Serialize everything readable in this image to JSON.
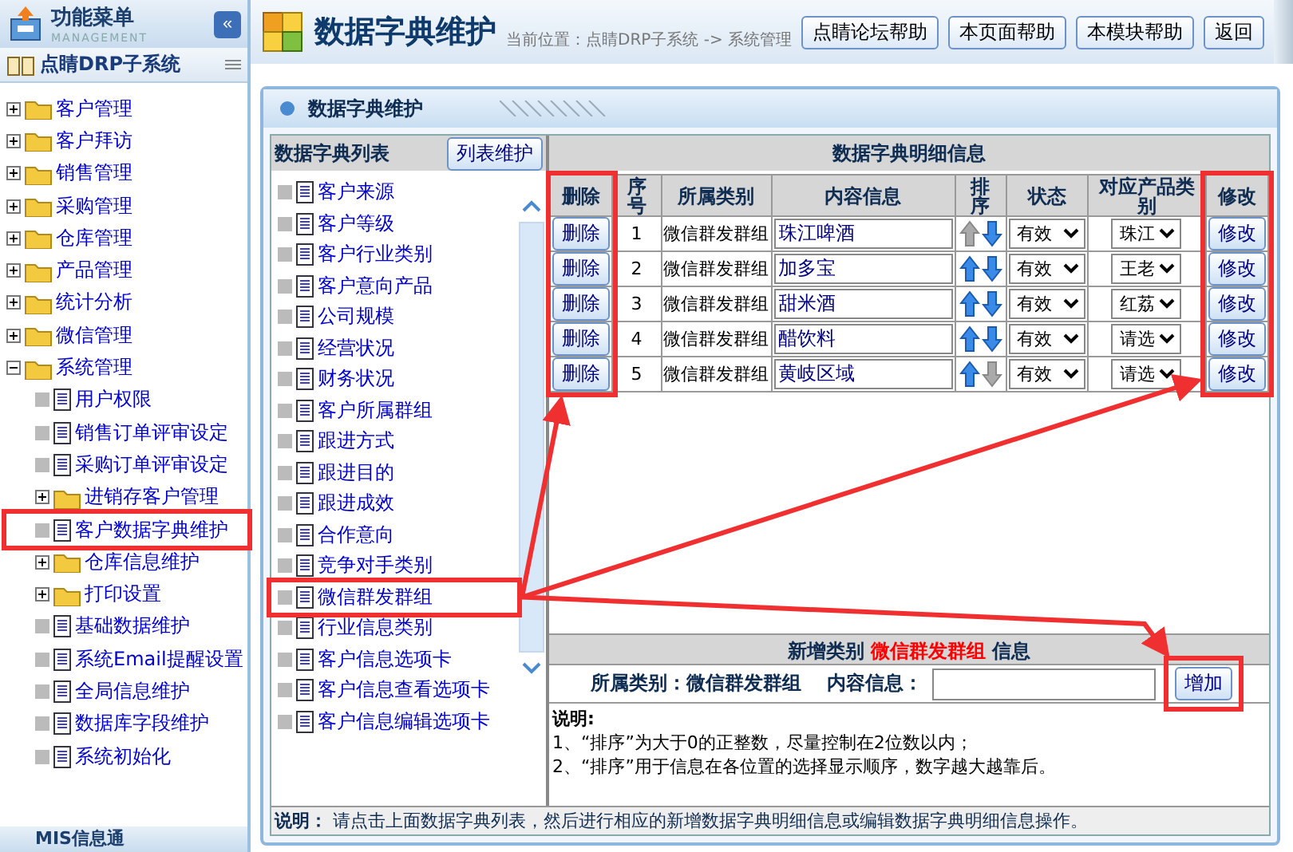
{
  "sidebar": {
    "title": "功能菜单",
    "subtitle": "MANAGEMENT",
    "collapse_symbol": "«",
    "system": "点睛DRP子系统",
    "items": [
      {
        "label": "客户管理",
        "kind": "folder",
        "expanded": false
      },
      {
        "label": "客户拜访",
        "kind": "folder",
        "expanded": false
      },
      {
        "label": "销售管理",
        "kind": "folder",
        "expanded": false
      },
      {
        "label": "采购管理",
        "kind": "folder",
        "expanded": false
      },
      {
        "label": "仓库管理",
        "kind": "folder",
        "expanded": false
      },
      {
        "label": "产品管理",
        "kind": "folder",
        "expanded": false
      },
      {
        "label": "统计分析",
        "kind": "folder",
        "expanded": false
      },
      {
        "label": "微信管理",
        "kind": "folder",
        "expanded": false
      },
      {
        "label": "系统管理",
        "kind": "folder",
        "expanded": true,
        "children": [
          {
            "label": "用户权限",
            "kind": "page",
            "highlighted": false
          },
          {
            "label": "销售订单评审设定",
            "kind": "page",
            "highlighted": false
          },
          {
            "label": "采购订单评审设定",
            "kind": "page",
            "highlighted": false
          },
          {
            "label": "进销存客户管理",
            "kind": "folder",
            "expanded": false
          },
          {
            "label": "客户数据字典维护",
            "kind": "page",
            "highlighted": true
          },
          {
            "label": "仓库信息维护",
            "kind": "folder",
            "expanded": false
          },
          {
            "label": "打印设置",
            "kind": "folder",
            "expanded": false
          },
          {
            "label": "基础数据维护",
            "kind": "page",
            "highlighted": false
          },
          {
            "label": "系统Email提醒设置",
            "kind": "page",
            "highlighted": false
          },
          {
            "label": "全局信息维护",
            "kind": "page",
            "highlighted": false
          },
          {
            "label": "数据库字段维护",
            "kind": "page",
            "highlighted": false
          },
          {
            "label": "系统初始化",
            "kind": "page",
            "highlighted": false
          }
        ]
      }
    ],
    "footer": "MIS信息通"
  },
  "header": {
    "title": "数据字典维护",
    "breadcrumb": "当前位置：点睛DRP子系统 -> 系统管理",
    "buttons": [
      "点睛论坛帮助",
      "本页面帮助",
      "本模块帮助",
      "返回"
    ]
  },
  "panel": {
    "title": "数据字典维护"
  },
  "dictionary_list": {
    "title": "数据字典列表",
    "button": "列表维护",
    "items": [
      {
        "label": "客户来源",
        "highlighted": false
      },
      {
        "label": "客户等级",
        "highlighted": false
      },
      {
        "label": "客户行业类别",
        "highlighted": false
      },
      {
        "label": "客户意向产品",
        "highlighted": false
      },
      {
        "label": "公司规模",
        "highlighted": false
      },
      {
        "label": "经营状况",
        "highlighted": false
      },
      {
        "label": "财务状况",
        "highlighted": false
      },
      {
        "label": "客户所属群组",
        "highlighted": false
      },
      {
        "label": "跟进方式",
        "highlighted": false
      },
      {
        "label": "跟进目的",
        "highlighted": false
      },
      {
        "label": "跟进成效",
        "highlighted": false
      },
      {
        "label": "合作意向",
        "highlighted": false
      },
      {
        "label": "竞争对手类别",
        "highlighted": false
      },
      {
        "label": "微信群发群组",
        "highlighted": true
      },
      {
        "label": "行业信息类别",
        "highlighted": false
      },
      {
        "label": "客户信息选项卡",
        "highlighted": false
      },
      {
        "label": "客户信息查看选项卡",
        "highlighted": false
      },
      {
        "label": "客户信息编辑选项卡",
        "highlighted": false
      }
    ]
  },
  "detail": {
    "title": "数据字典明细信息",
    "columns": [
      {
        "label": "删除",
        "highlighted": true
      },
      {
        "label": "序号",
        "highlighted": false
      },
      {
        "label": "所属类别",
        "highlighted": false
      },
      {
        "label": "内容信息",
        "highlighted": false
      },
      {
        "label": "排序",
        "highlighted": false
      },
      {
        "label": "状态",
        "highlighted": false
      },
      {
        "label": "对应产品类别",
        "highlighted": false
      },
      {
        "label": "修改",
        "highlighted": true
      }
    ],
    "rows": [
      {
        "delete": "删除",
        "index": "1",
        "category": "微信群发群组",
        "content": "珠江啤酒",
        "up_enabled": false,
        "down_enabled": true,
        "status": "有效",
        "product_category": "珠江",
        "edit": "修改"
      },
      {
        "delete": "删除",
        "index": "2",
        "category": "微信群发群组",
        "content": "加多宝",
        "up_enabled": true,
        "down_enabled": true,
        "status": "有效",
        "product_category": "王老",
        "edit": "修改"
      },
      {
        "delete": "删除",
        "index": "3",
        "category": "微信群发群组",
        "content": "甜米酒",
        "up_enabled": true,
        "down_enabled": true,
        "status": "有效",
        "product_category": "红荔",
        "edit": "修改"
      },
      {
        "delete": "删除",
        "index": "4",
        "category": "微信群发群组",
        "content": "醋饮料",
        "up_enabled": true,
        "down_enabled": true,
        "status": "有效",
        "product_category": "请选",
        "edit": "修改"
      },
      {
        "delete": "删除",
        "index": "5",
        "category": "微信群发群组",
        "content": "黄岐区域",
        "up_enabled": true,
        "down_enabled": false,
        "status": "有效",
        "product_category": "请选",
        "edit": "修改"
      }
    ]
  },
  "add_form": {
    "title_prefix": "新增类别",
    "title_category": "微信群发群组",
    "title_suffix": "信息",
    "category_label": "所属类别：微信群发群组",
    "content_label": "内容信息：",
    "button": "增加",
    "button_highlighted": true
  },
  "notes": {
    "title": "说明:",
    "lines": [
      "1、“排序”为大于0的正整数，尽量控制在2位数以内；",
      "2、“排序”用于信息在各位置的选择显示顺序，数字越大越靠后。"
    ]
  },
  "footer_note": "**说明：** 请点击上面数据字典列表，然后进行相应的新增数据字典明细信息或编辑数据字典明细信息操作。"
}
